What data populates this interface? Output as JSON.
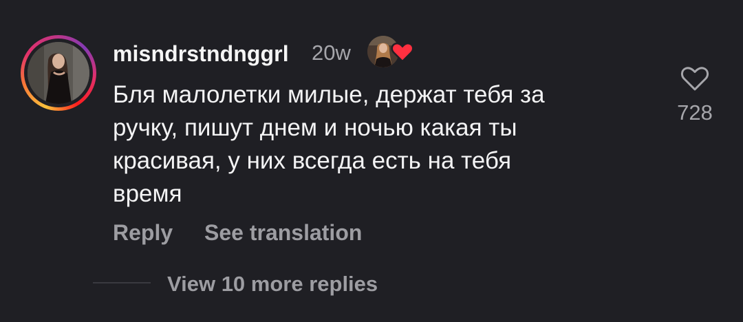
{
  "comment": {
    "username": "misndrstndnggrl",
    "timestamp": "20w",
    "text": "Бля малолетки милые, держат тебя за\nручку, пишут днем и ночью какая ты\nкрасивая, у них всегда есть на тебя\nвремя",
    "like_count": "728",
    "author_liked": true
  },
  "actions": {
    "reply_label": "Reply",
    "translation_label": "See translation"
  },
  "replies": {
    "view_more_label": "View 10 more replies"
  },
  "icons": {
    "like": "heart-outline-icon",
    "author_like": "heart-filled-icon"
  },
  "colors": {
    "background": "#1f1f24",
    "primary_text": "#f3f3f4",
    "secondary_text": "#9d9da2",
    "heart_red": "#ff3040",
    "story_ring": [
      "#f9c23c",
      "#f77737",
      "#e1306c",
      "#c13584",
      "#833ab4"
    ]
  }
}
